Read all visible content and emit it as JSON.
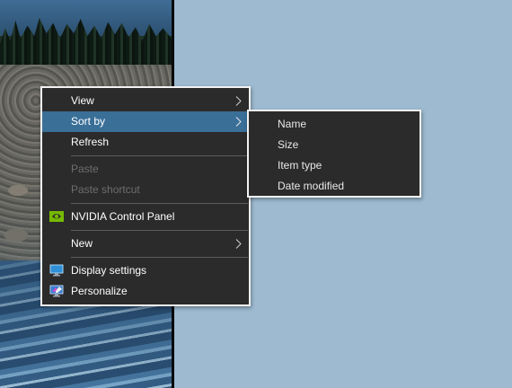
{
  "context_menu": {
    "items": [
      {
        "label": "View",
        "has_submenu": true
      },
      {
        "label": "Sort by",
        "has_submenu": true,
        "highlighted": true
      },
      {
        "label": "Refresh"
      },
      {
        "label": "Paste",
        "disabled": true
      },
      {
        "label": "Paste shortcut",
        "disabled": true
      },
      {
        "label": "NVIDIA Control Panel",
        "icon": "nvidia-icon"
      },
      {
        "label": "New",
        "has_submenu": true
      },
      {
        "label": "Display settings",
        "icon": "display-icon"
      },
      {
        "label": "Personalize",
        "icon": "personalize-icon"
      }
    ]
  },
  "sort_submenu": {
    "items": [
      {
        "label": "Name"
      },
      {
        "label": "Size"
      },
      {
        "label": "Item type"
      },
      {
        "label": "Date modified"
      }
    ]
  },
  "colors": {
    "menu_background": "#2b2b2b",
    "menu_border": "#f2f2f2",
    "highlight": "#3a6f98",
    "disabled_text": "#6d6d6d",
    "desktop_background": "#9dbad0",
    "nvidia_green": "#76b900"
  }
}
